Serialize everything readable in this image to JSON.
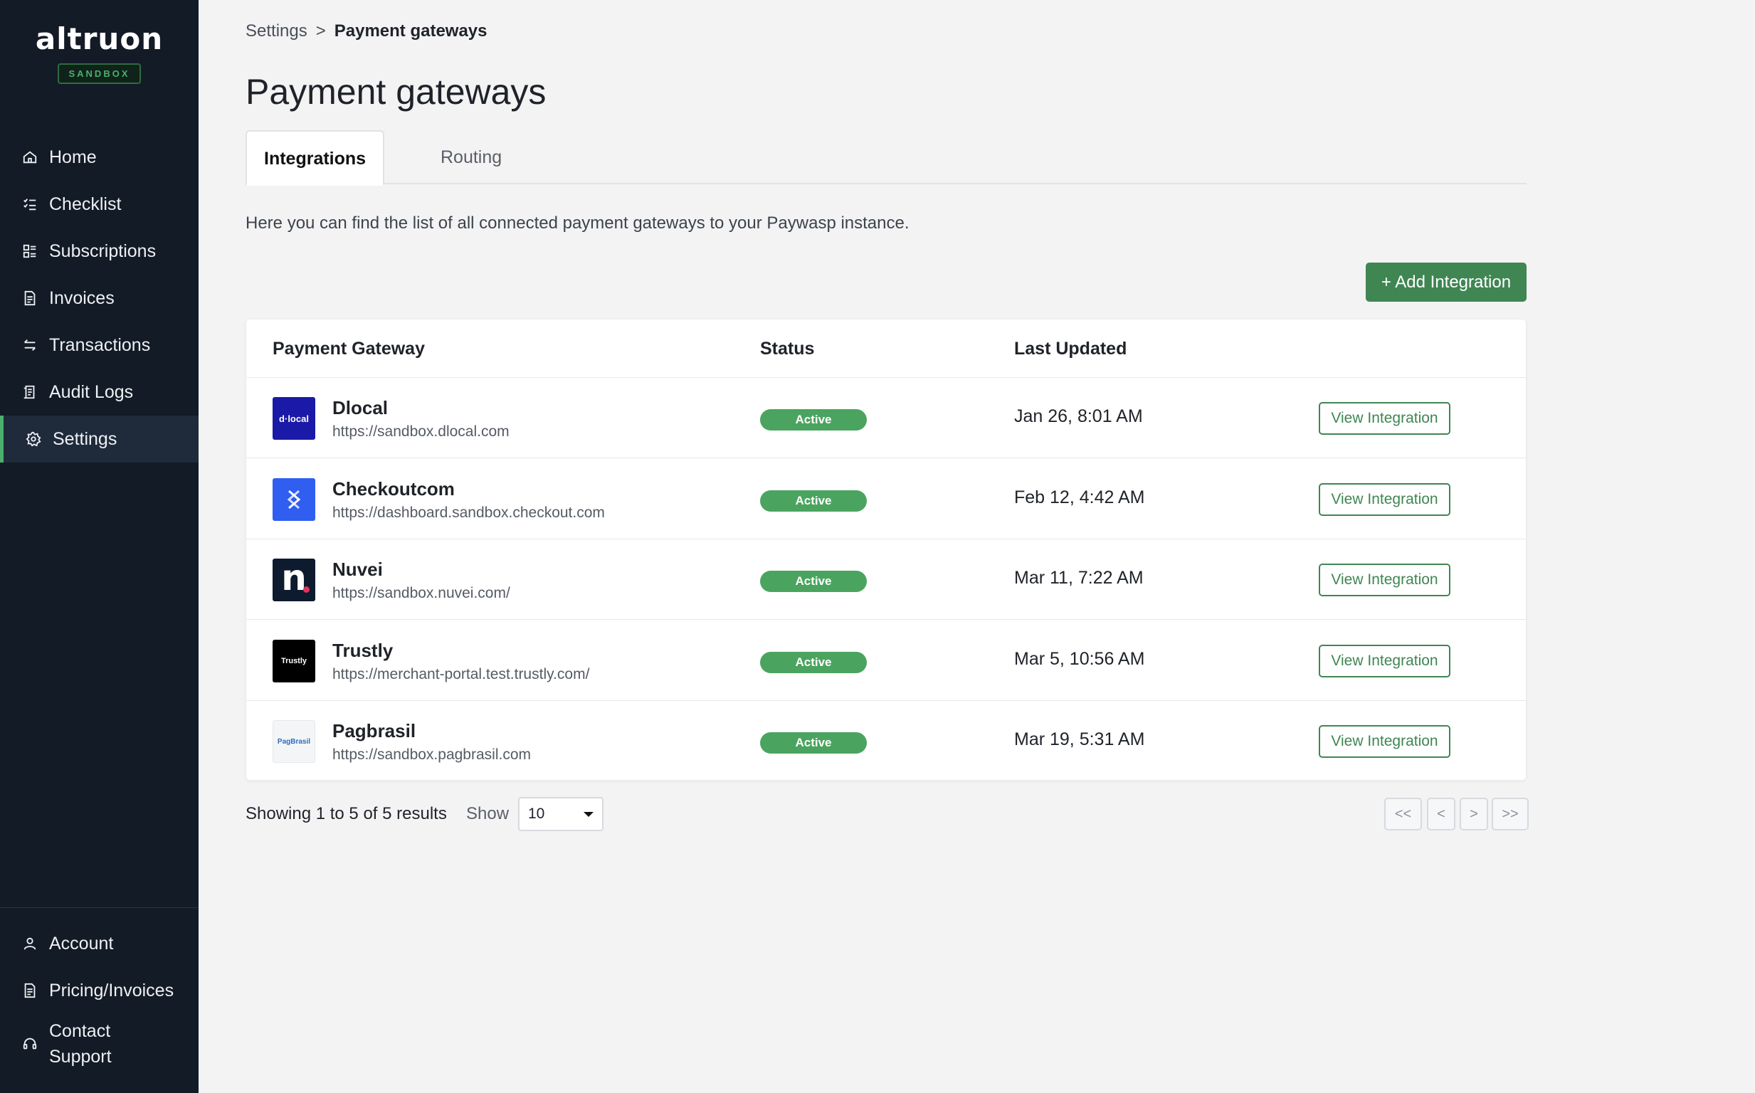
{
  "sidebar": {
    "brand": "altruon",
    "badge": "SANDBOX",
    "items": [
      {
        "label": "Home",
        "icon": "home-icon"
      },
      {
        "label": "Checklist",
        "icon": "checklist-icon"
      },
      {
        "label": "Subscriptions",
        "icon": "subscriptions-icon"
      },
      {
        "label": "Invoices",
        "icon": "invoice-icon"
      },
      {
        "label": "Transactions",
        "icon": "transactions-icon"
      },
      {
        "label": "Audit Logs",
        "icon": "audit-logs-icon"
      },
      {
        "label": "Settings",
        "icon": "gear-icon",
        "active": true
      }
    ],
    "bottom_items": [
      {
        "label": "Account",
        "icon": "user-icon"
      },
      {
        "label": "Pricing/Invoices",
        "icon": "document-icon"
      },
      {
        "label": "Contact Support",
        "icon": "headset-icon"
      }
    ]
  },
  "breadcrumb": {
    "parent": "Settings",
    "separator": ">",
    "current": "Payment gateways"
  },
  "page_title": "Payment gateways",
  "tabs": [
    {
      "label": "Integrations",
      "active": true
    },
    {
      "label": "Routing",
      "active": false
    }
  ],
  "description": "Here you can find the list of all connected payment gateways to your Paywasp instance.",
  "add_button": "+ Add Integration",
  "table": {
    "headers": [
      "Payment Gateway",
      "Status",
      "Last Updated"
    ],
    "rows": [
      {
        "name": "Dlocal",
        "url": "https://sandbox.dlocal.com",
        "status": "Active",
        "updated": "Jan 26, 8:01 AM",
        "action": "View Integration",
        "logo_text": "d·local",
        "logo_bg": "#1b1aa8"
      },
      {
        "name": "Checkoutcom",
        "url": "https://dashboard.sandbox.checkout.com",
        "status": "Active",
        "updated": "Feb 12, 4:42 AM",
        "action": "View Integration",
        "logo_text": "",
        "logo_bg": "#2f5ef0"
      },
      {
        "name": "Nuvei",
        "url": "https://sandbox.nuvei.com/",
        "status": "Active",
        "updated": "Mar 11, 7:22 AM",
        "action": "View Integration",
        "logo_text": "n",
        "logo_bg": "#0e1b2e"
      },
      {
        "name": "Trustly",
        "url": "https://merchant-portal.test.trustly.com/",
        "status": "Active",
        "updated": "Mar 5, 10:56 AM",
        "action": "View Integration",
        "logo_text": "Trustly",
        "logo_bg": "#000000"
      },
      {
        "name": "Pagbrasil",
        "url": "https://sandbox.pagbrasil.com",
        "status": "Active",
        "updated": "Mar 19, 5:31 AM",
        "action": "View Integration",
        "logo_text": "PagBrasil",
        "logo_bg": "#f4f5f6"
      }
    ]
  },
  "footer": {
    "showing": "Showing 1 to 5 of 5 results",
    "show_label": "Show",
    "page_size": "10",
    "pager": [
      "<<",
      "<",
      ">",
      ">>"
    ]
  },
  "colors": {
    "accent": "#3f8653",
    "sidebar_bg": "#131b26",
    "status_active": "#4aa45f"
  }
}
